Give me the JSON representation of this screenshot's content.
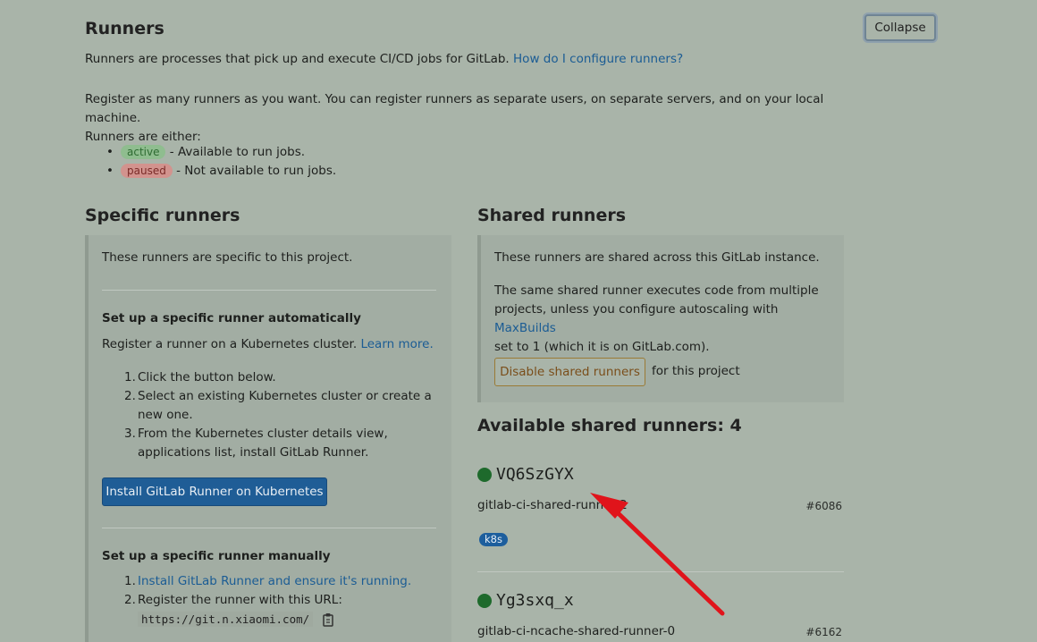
{
  "runners": {
    "title": "Runners",
    "intro": "Runners are processes that pick up and execute CI/CD jobs for GitLab.",
    "intro_link": "How do I configure runners?",
    "collapse_label": "Collapse",
    "register_line1": "Register as many runners as you want. You can register runners as separate users, on separate servers, and on your local machine.",
    "register_line2": "Runners are either:",
    "states": [
      {
        "badge": "active",
        "text": "- Available to run jobs."
      },
      {
        "badge": "paused",
        "text": "- Not available to run jobs."
      }
    ]
  },
  "specific": {
    "title": "Specific runners",
    "desc": "These runners are specific to this project.",
    "auto_title": "Set up a specific runner automatically",
    "auto_desc": "Register a runner on a Kubernetes cluster.",
    "auto_link": "Learn more.",
    "steps": [
      {
        "num": "1.",
        "line1": "Click the button below.",
        "line2": ""
      },
      {
        "num": "2.",
        "line1": "Select an existing Kubernetes cluster or create a",
        "line2": "new one."
      },
      {
        "num": "3.",
        "line1": "From the Kubernetes cluster details view,",
        "line2": "applications list, install GitLab Runner."
      }
    ],
    "install_button": "Install GitLab Runner on Kubernetes",
    "manual_title": "Set up a specific runner manually",
    "manual_steps": [
      {
        "num": "1.",
        "link": "Install GitLab Runner and ensure it's running."
      },
      {
        "num": "2.",
        "text": "Register the runner with this URL:"
      }
    ],
    "url": "https://git.n.xiaomi.com/"
  },
  "shared": {
    "title": "Shared runners",
    "desc": "These runners are shared across this GitLab instance.",
    "desc2_line1": "The same shared runner executes code from multiple",
    "desc2_line2_pre": "projects, unless you configure autoscaling with",
    "desc2_link": "MaxBuilds",
    "desc2_line3": "set to 1 (which it is on GitLab.com).",
    "disable_button": "Disable shared runners",
    "disable_suffix": "for this project",
    "available_title": "Available shared runners: 4",
    "runners": [
      {
        "name": "VQ6SzGYX",
        "desc": "gitlab-ci-shared-runner-2",
        "id": "#6086",
        "tag": "k8s",
        "status_color": "#1e6a2c"
      },
      {
        "name": "Yg3sxq_x",
        "desc": "gitlab-ci-ncache-shared-runner-0",
        "id": "#6162",
        "tag": "",
        "status_color": "#1e6a2c"
      }
    ]
  }
}
